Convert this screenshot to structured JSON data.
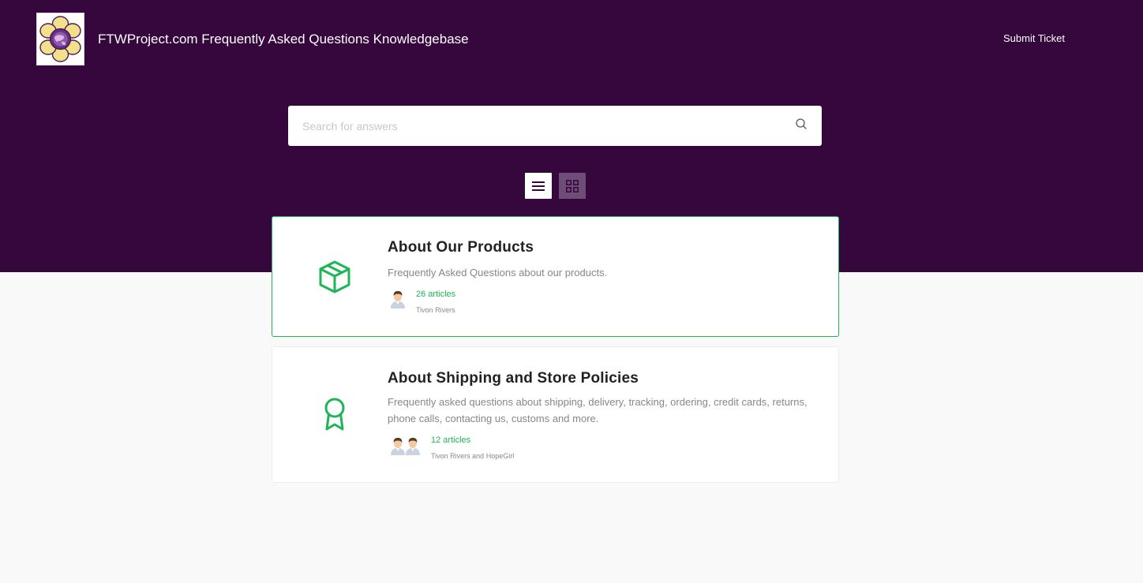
{
  "header": {
    "site_title": "FTWProject.com Frequently Asked Questions Knowledgebase",
    "submit_ticket_label": "Submit Ticket"
  },
  "search": {
    "placeholder": "Search for answers",
    "value": ""
  },
  "view_toggle": {
    "list_icon": "list-icon",
    "grid_icon": "grid-icon",
    "active": "list"
  },
  "categories": [
    {
      "icon": "package-icon",
      "title": "About Our Products",
      "description": "Frequently Asked Questions about our products.",
      "article_count": "26 articles",
      "authors": "Tivon Rivers"
    },
    {
      "icon": "award-ribbon-icon",
      "title": "About Shipping and Store Policies",
      "description": "Frequently asked questions about shipping, delivery, tracking, ordering, credit cards, returns, phone calls, contacting us, customs and more.",
      "article_count": "12 articles",
      "authors": "Tivon Rivers and HopeGirl"
    }
  ],
  "colors": {
    "hero_background": "#35073d",
    "accent_green": "#1fb558",
    "page_background": "#f9f9f9",
    "grid_button": "#6e4e78"
  }
}
